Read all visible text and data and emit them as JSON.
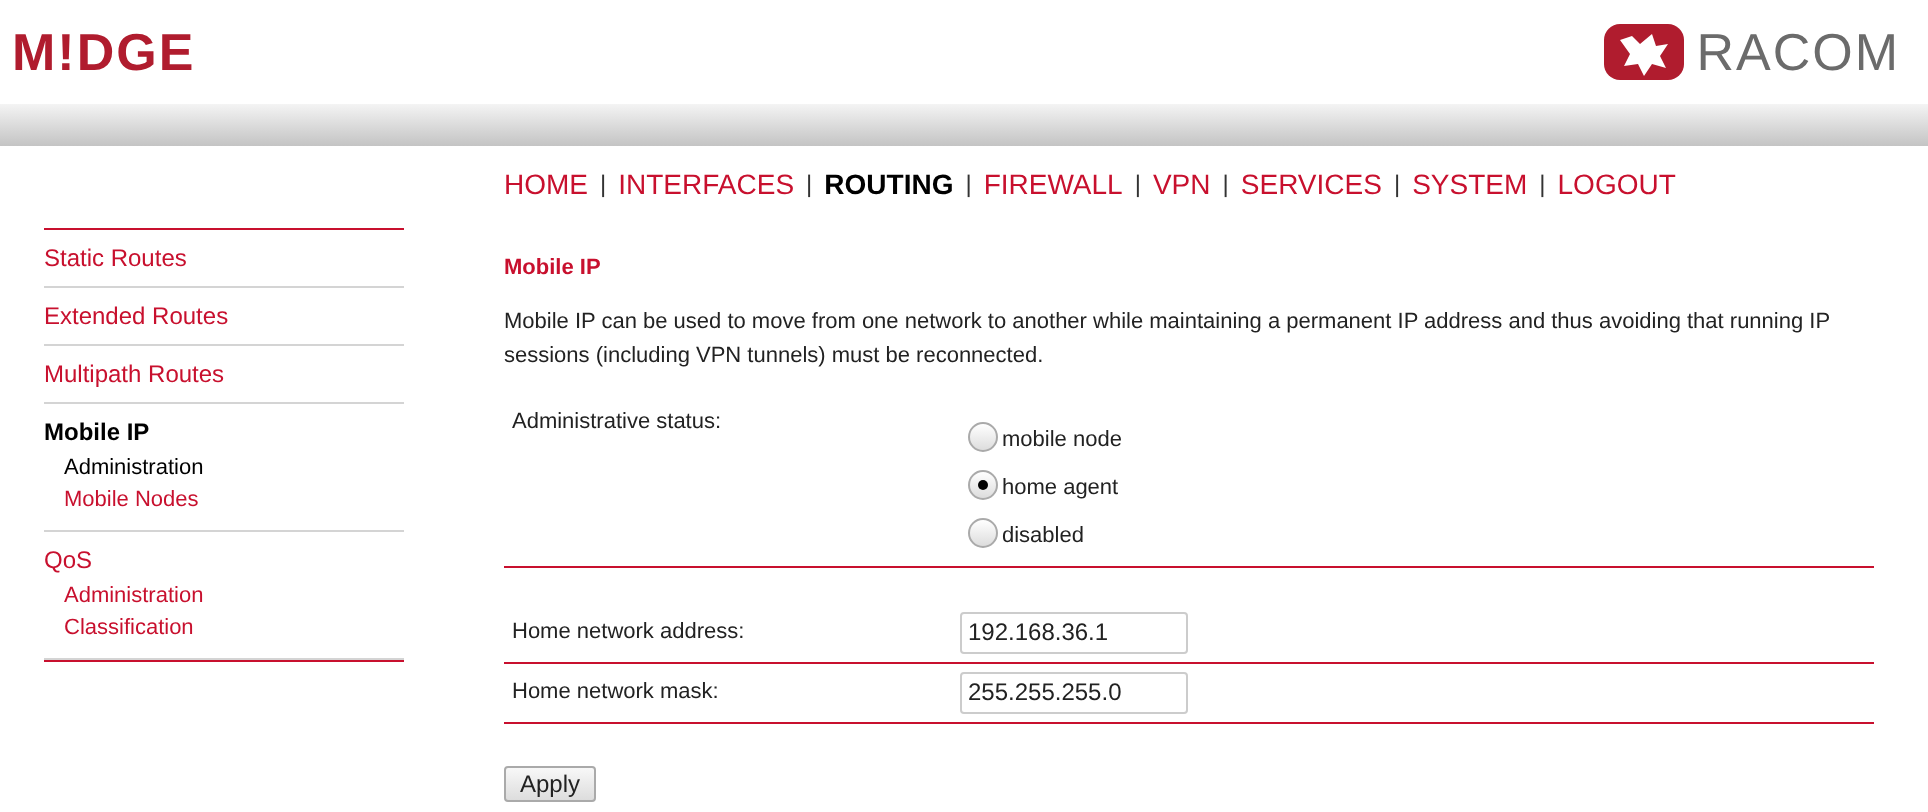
{
  "header": {
    "logo_left": "M!DGE",
    "logo_right": "RACOM"
  },
  "nav": [
    {
      "label": "HOME",
      "selected": false
    },
    {
      "separator": "|",
      "label": "INTERFACES",
      "selected": false
    },
    {
      "separator": "|",
      "label": "ROUTING",
      "selected": true
    },
    {
      "separator": "|",
      "label": "FIREWALL",
      "selected": false
    },
    {
      "separator": "|",
      "label": "VPN",
      "selected": false
    },
    {
      "separator": "|",
      "label": "SERVICES",
      "selected": false
    },
    {
      "separator": "|",
      "label": "SYSTEM",
      "selected": false
    },
    {
      "separator": "|",
      "label": "LOGOUT",
      "selected": false
    }
  ],
  "sidebar": {
    "items": [
      {
        "label": "Static Routes",
        "selected": false
      },
      {
        "label": "Extended Routes",
        "selected": false
      },
      {
        "label": "Multipath Routes",
        "selected": false
      },
      {
        "label": "Mobile IP",
        "selected": true,
        "children": [
          {
            "label": "Administration",
            "selected": true
          },
          {
            "label": "Mobile Nodes",
            "selected": false
          }
        ]
      },
      {
        "label": "QoS",
        "selected": false,
        "children": [
          {
            "label": "Administration",
            "selected": false
          },
          {
            "label": "Classification",
            "selected": false
          }
        ]
      }
    ]
  },
  "content": {
    "title": "Mobile IP",
    "description": "Mobile IP can be used to move from one network to another while maintaining a permanent IP address and thus avoiding that running IP sessions (including VPN tunnels) must be reconnected.",
    "status": {
      "label": "Administrative status:",
      "options": [
        {
          "label": "mobile node",
          "selected": false
        },
        {
          "label": "home agent",
          "selected": true
        },
        {
          "label": "disabled",
          "selected": false
        }
      ]
    },
    "fields": [
      {
        "label": "Home network address:",
        "value": "192.168.36.1"
      },
      {
        "label": "Home network mask:",
        "value": "255.255.255.0"
      }
    ],
    "apply": "Apply"
  }
}
